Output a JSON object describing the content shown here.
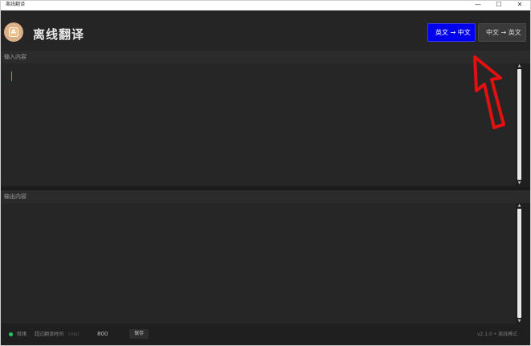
{
  "os_window": {
    "title": "离线翻译",
    "minimize_glyph": "—",
    "maximize_glyph": "☐",
    "close_glyph": "✕"
  },
  "header": {
    "logo_letter": "A",
    "title": "离线翻译",
    "mode_buttons": [
      {
        "label": "英文 → 中文",
        "active": true
      },
      {
        "label": "中文 → 英文",
        "active": false
      }
    ]
  },
  "input": {
    "label": "输入内容",
    "value": ""
  },
  "output": {
    "label": "输出内容",
    "value": ""
  },
  "status": {
    "state": "就绪",
    "timeout_label": "超过翻译时间",
    "timeout_unit": "(ms)",
    "timeout_value": "800",
    "save_label": "保存",
    "version": "v2.1.0 • 离线模式"
  },
  "colors": {
    "accent_blue": "#0000ee",
    "status_green": "#29c46a",
    "annotation_red": "#e31010"
  }
}
